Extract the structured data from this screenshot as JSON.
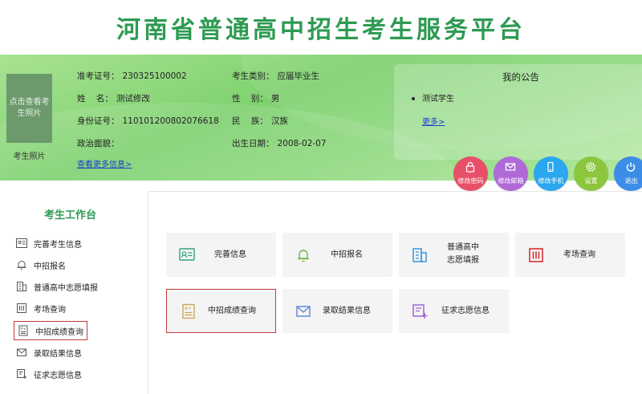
{
  "header": {
    "title": "河南省普通高中招生考生服务平台"
  },
  "profile": {
    "photo_text": "点击查看考生照片",
    "photo_caption": "考生照片",
    "fields": [
      {
        "label": "准考证号：",
        "value": "230325100002"
      },
      {
        "label": "姓    名：",
        "value": "测试修改"
      },
      {
        "label": "身份证号：",
        "value": "110101200802076618"
      },
      {
        "label": "政治面貌：",
        "value": ""
      },
      {
        "label": "考生类别：",
        "value": "应届毕业生"
      },
      {
        "label": "性    别：",
        "value": "男"
      },
      {
        "label": "民    族：",
        "value": "汉族"
      },
      {
        "label": "出生日期：",
        "value": "2008-02-07"
      }
    ],
    "more_link": "查看更多信息>"
  },
  "notice": {
    "title": "我的公告",
    "items": [
      "测试学生"
    ],
    "more": "更多>"
  },
  "actions": [
    {
      "label": "修改密码",
      "color": "#e8506a",
      "icon": "lock-icon"
    },
    {
      "label": "修改邮箱",
      "color": "#b06ad8",
      "icon": "mail-icon"
    },
    {
      "label": "修改手机",
      "color": "#2aa7ee",
      "icon": "phone-icon"
    },
    {
      "label": "设置",
      "color": "#8cc63e",
      "icon": "gear-icon"
    },
    {
      "label": "退出",
      "color": "#3b8de8",
      "icon": "power-icon"
    }
  ],
  "sidebar": {
    "title": "考生工作台",
    "items": [
      {
        "label": "完善考生信息"
      },
      {
        "label": "中招报名"
      },
      {
        "label": "普通高中志愿填报"
      },
      {
        "label": "考场查询"
      },
      {
        "label": "中招成绩查询"
      },
      {
        "label": "录取结果信息"
      },
      {
        "label": "征求志愿信息"
      }
    ]
  },
  "tiles": [
    {
      "label": "完善信息"
    },
    {
      "label": "中招报名"
    },
    {
      "label_line1": "普通高中",
      "label_line2": "志愿填报"
    },
    {
      "label": "考场查询"
    },
    {
      "label": "中招成绩查询"
    },
    {
      "label": "录取结果信息"
    },
    {
      "label": "征求志愿信息"
    }
  ],
  "colors": {
    "brand_green": "#2e9a52",
    "active_outline": "#c23b3b",
    "link_blue": "#1a3fd0"
  }
}
